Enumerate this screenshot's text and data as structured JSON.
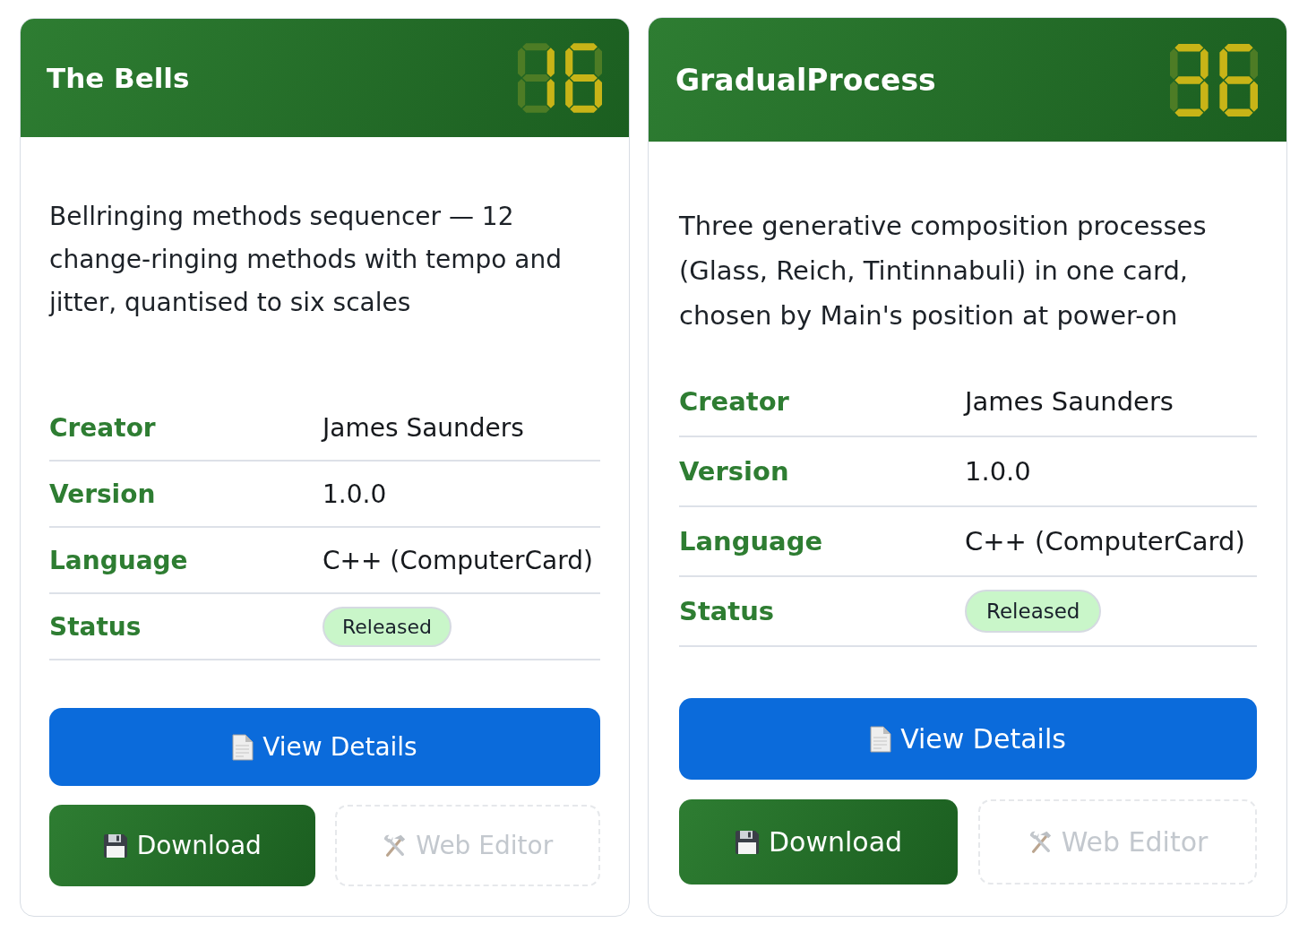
{
  "cards": [
    {
      "title": "The Bells",
      "display": [
        {
          "top": false,
          "top_right": true,
          "bottom_right": true,
          "bottom": false,
          "bottom_left": false,
          "top_left": false,
          "middle": false
        },
        {
          "top": true,
          "top_right": false,
          "bottom_right": true,
          "bottom": true,
          "bottom_left": true,
          "top_left": true,
          "middle": true
        }
      ],
      "description": "Bellringing methods sequencer — 12 change-ringing methods with tempo and jitter, quantised to six scales",
      "details": [
        {
          "kind": "text",
          "label": "Creator",
          "value": "James Saunders"
        },
        {
          "kind": "text",
          "label": "Version",
          "value": "1.0.0"
        },
        {
          "kind": "text",
          "label": "Language",
          "value": "C++ (ComputerCard)"
        },
        {
          "kind": "badge",
          "label": "Status",
          "value": "Released"
        }
      ],
      "buttons": [
        {
          "kind": "details",
          "label": "View Details",
          "disabled": false
        },
        {
          "kind": "download",
          "label": "Download",
          "disabled": false
        },
        {
          "kind": "editor",
          "label": "Web Editor",
          "disabled": true
        }
      ]
    },
    {
      "title": "GradualProcess",
      "display": [
        {
          "top": true,
          "top_right": true,
          "bottom_right": true,
          "bottom": true,
          "bottom_left": false,
          "top_left": false,
          "middle": true
        },
        {
          "top": true,
          "top_right": false,
          "bottom_right": true,
          "bottom": true,
          "bottom_left": true,
          "top_left": true,
          "middle": true
        }
      ],
      "description": "Three generative composition processes (Glass, Reich, Tintinnabuli) in one card, chosen by Main's position at power-on",
      "details": [
        {
          "kind": "text",
          "label": "Creator",
          "value": "James Saunders"
        },
        {
          "kind": "text",
          "label": "Version",
          "value": "1.0.0"
        },
        {
          "kind": "text",
          "label": "Language",
          "value": "C++ (ComputerCard)"
        },
        {
          "kind": "badge",
          "label": "Status",
          "value": "Released"
        }
      ],
      "buttons": [
        {
          "kind": "details",
          "label": "View Details",
          "disabled": false
        },
        {
          "kind": "download",
          "label": "Download",
          "disabled": false
        },
        {
          "kind": "editor",
          "label": "Web Editor",
          "disabled": true
        }
      ]
    }
  ]
}
